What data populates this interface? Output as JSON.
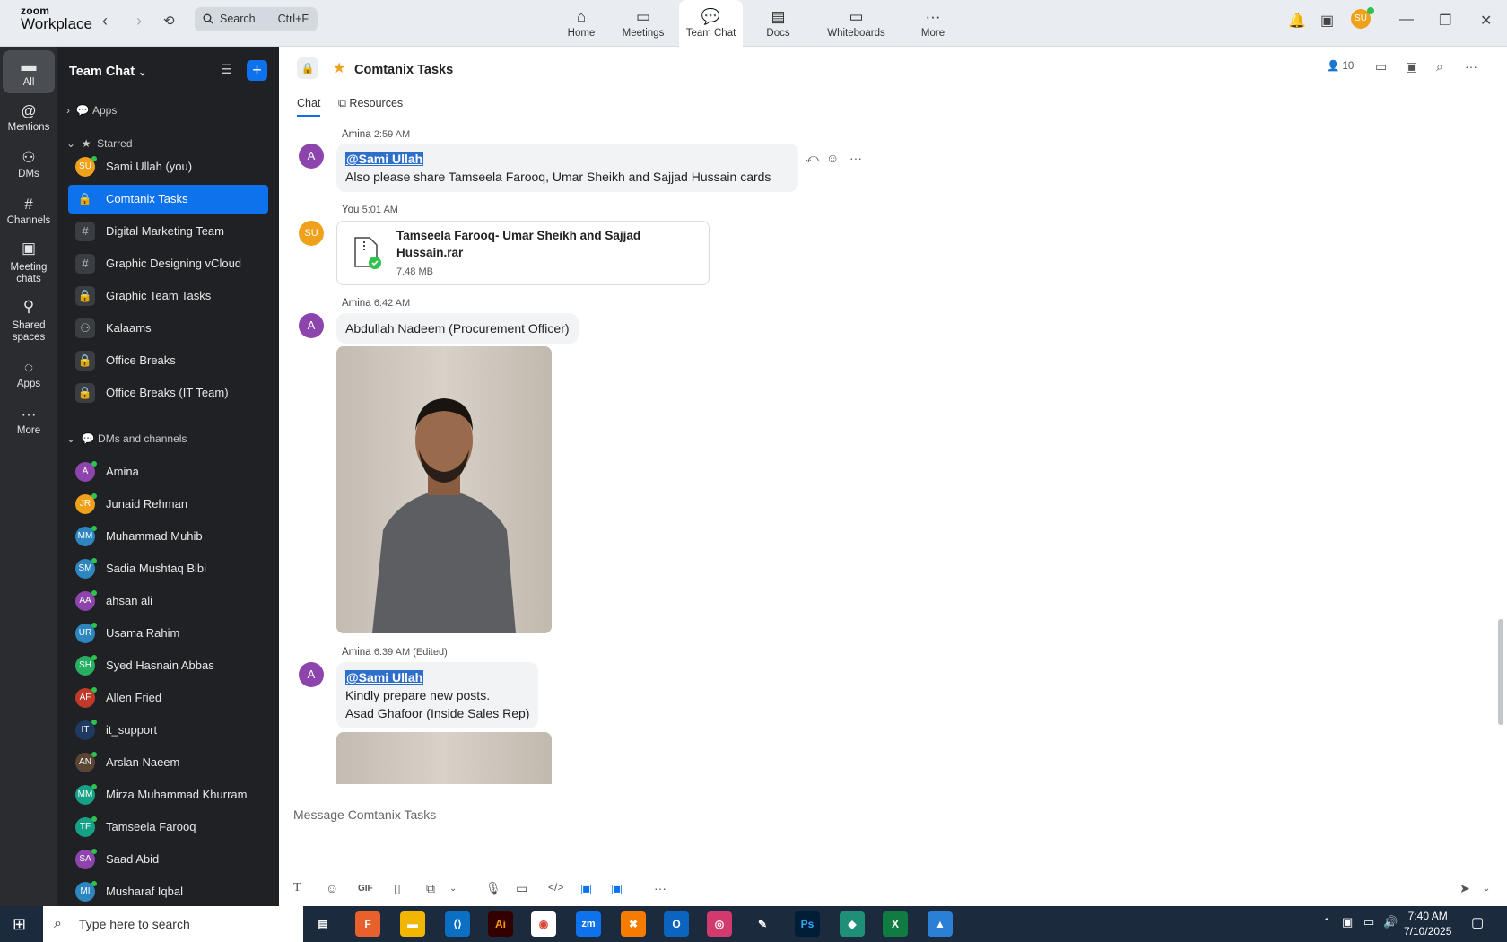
{
  "app": {
    "brand_top": "zoom",
    "brand_bottom": "Workplace"
  },
  "search": {
    "label": "Search",
    "shortcut": "Ctrl+F"
  },
  "topnav": [
    {
      "label": "Home",
      "icon": "home-icon"
    },
    {
      "label": "Meetings",
      "icon": "video-icon"
    },
    {
      "label": "Team Chat",
      "icon": "chat-icon"
    },
    {
      "label": "Docs",
      "icon": "doc-icon"
    },
    {
      "label": "Whiteboards",
      "icon": "whiteboard-icon"
    },
    {
      "label": "More",
      "icon": "more-icon"
    }
  ],
  "user": {
    "initials": "SU"
  },
  "rail": [
    {
      "label": "All"
    },
    {
      "label": "Mentions"
    },
    {
      "label": "DMs"
    },
    {
      "label": "Channels"
    },
    {
      "label": "Meeting chats"
    },
    {
      "label": "Shared spaces"
    },
    {
      "label": "Apps"
    },
    {
      "label": "More"
    }
  ],
  "sidebar": {
    "title": "Team Chat",
    "apps_label": "Apps",
    "starred_label": "Starred",
    "dms_label": "DMs and channels",
    "starred": [
      {
        "label": "Sami Ullah (you)",
        "initials": "SU",
        "color": "#f0a11b",
        "kind": "avatar"
      },
      {
        "label": "Comtanix Tasks",
        "kind": "lock",
        "active": true
      },
      {
        "label": "Digital Marketing Team",
        "kind": "hash"
      },
      {
        "label": "Graphic Designing vCloud",
        "kind": "hash"
      },
      {
        "label": "Graphic Team Tasks",
        "kind": "lock"
      },
      {
        "label": "Kalaams",
        "kind": "group"
      },
      {
        "label": "Office Breaks",
        "kind": "lock"
      },
      {
        "label": "Office Breaks (IT Team)",
        "kind": "lock"
      }
    ],
    "dms": [
      {
        "label": "Amina",
        "initials": "A",
        "color": "#8e44ad"
      },
      {
        "label": "Junaid Rehman",
        "initials": "JR",
        "color": "#f0a11b"
      },
      {
        "label": "Muhammad Muhib",
        "initials": "MM",
        "color": "#2e86c1"
      },
      {
        "label": "Sadia Mushtaq Bibi",
        "initials": "SM",
        "color": "#2e86c1"
      },
      {
        "label": "ahsan ali",
        "initials": "AA",
        "color": "#8e44ad"
      },
      {
        "label": "Usama Rahim",
        "initials": "UR",
        "color": "#2e86c1"
      },
      {
        "label": "Syed Hasnain Abbas",
        "initials": "SH",
        "color": "#27ae60"
      },
      {
        "label": "Allen Fried",
        "initials": "AF",
        "color": "#c0392b"
      },
      {
        "label": "it_support",
        "initials": "IT",
        "color": "#1f3a60"
      },
      {
        "label": "Arslan Naeem",
        "initials": "AN",
        "color": "#5b4636"
      },
      {
        "label": "Mirza Muhammad Khurram",
        "initials": "MM",
        "color": "#16a085"
      },
      {
        "label": "Tamseela Farooq",
        "initials": "TF",
        "color": "#16a085"
      },
      {
        "label": "Saad Abid",
        "initials": "SA",
        "color": "#8e44ad"
      },
      {
        "label": "Musharaf Iqbal",
        "initials": "MI",
        "color": "#2e86c1"
      }
    ]
  },
  "channel": {
    "title": "Comtanix Tasks",
    "members": "10",
    "tabs": [
      "Chat",
      "Resources"
    ]
  },
  "messages": [
    {
      "author": "Amina",
      "time": "2:59 AM",
      "mention": "@Sami Ullah",
      "text": "Also please share Tamseela Farooq, Umar Sheikh and Sajjad Hussain cards"
    },
    {
      "author": "You",
      "time": "5:01 AM",
      "file_name_1": "Tamseela Farooq- Umar Sheikh and Sajjad",
      "file_name_2": "Hussain.rar",
      "file_size": "7.48 MB"
    },
    {
      "author": "Amina",
      "time": "6:42 AM",
      "text": "Abdullah Nadeem (Procurement Officer)"
    },
    {
      "author": "Amina",
      "time": "6:39 AM (Edited)",
      "mention": "@Sami Ullah",
      "line1": "Kindly prepare new posts.",
      "line2": "Asad Ghafoor (Inside Sales Rep)"
    }
  ],
  "composer": {
    "placeholder": "Message Comtanix Tasks",
    "gif": "GIF"
  },
  "taskbar": {
    "search": "Type here to search",
    "time": "7:40 AM",
    "date": "7/10/2025"
  },
  "colors": {
    "accent": "#0e72ed",
    "sidebar_bg": "#1f2124",
    "rail_bg": "#2a2c30"
  }
}
